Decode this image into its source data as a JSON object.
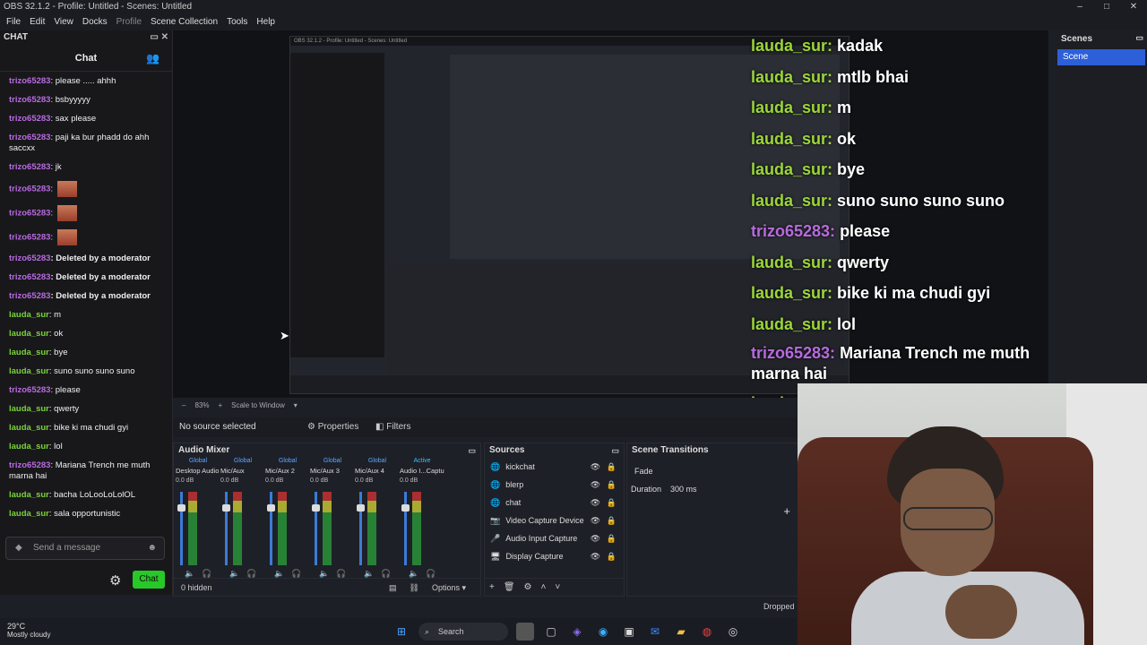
{
  "window": {
    "title": "OBS 32.1.2 - Profile: Untitled - Scenes: Untitled",
    "controls": [
      "–",
      "□",
      "✕"
    ]
  },
  "menu": [
    "File",
    "Edit",
    "View",
    "Docks",
    "Profile",
    "Scene Collection",
    "Tools",
    "Help"
  ],
  "chat_dock": {
    "dock_title": "CHAT",
    "header": "Chat",
    "messages": [
      {
        "user": "trizo65283",
        "text": "please ..... ahhh",
        "cls": "u1"
      },
      {
        "user": "trizo65283",
        "text": "bsbyyyyy",
        "cls": "u1"
      },
      {
        "user": "trizo65283",
        "text": "sax please",
        "cls": "u1"
      },
      {
        "user": "trizo65283",
        "text": "paji ka bur phadd do ahh saccxx",
        "cls": "u1"
      },
      {
        "user": "trizo65283",
        "text": "jk",
        "cls": "u1"
      },
      {
        "user": "trizo65283",
        "text": "",
        "cls": "u1",
        "emote": true
      },
      {
        "user": "trizo65283",
        "text": "",
        "cls": "u1",
        "emote": true
      },
      {
        "user": "trizo65283",
        "text": "",
        "cls": "u1",
        "emote": true
      },
      {
        "user": "trizo65283",
        "text": "Deleted by a moderator",
        "cls": "u1",
        "sys": true
      },
      {
        "user": "trizo65283",
        "text": "Deleted by a moderator",
        "cls": "u1",
        "sys": true
      },
      {
        "user": "trizo65283",
        "text": "Deleted by a moderator",
        "cls": "u1",
        "sys": true
      },
      {
        "user": "lauda_sur",
        "text": "m",
        "cls": "u2"
      },
      {
        "user": "lauda_sur",
        "text": "ok",
        "cls": "u2"
      },
      {
        "user": "lauda_sur",
        "text": "bye",
        "cls": "u2"
      },
      {
        "user": "lauda_sur",
        "text": "suno suno suno suno",
        "cls": "u2"
      },
      {
        "user": "trizo65283",
        "text": "please",
        "cls": "u1"
      },
      {
        "user": "lauda_sur",
        "text": "qwerty",
        "cls": "u2"
      },
      {
        "user": "lauda_sur",
        "text": "bike ki ma chudi gyi",
        "cls": "u2"
      },
      {
        "user": "lauda_sur",
        "text": "lol",
        "cls": "u2"
      },
      {
        "user": "trizo65283",
        "text": "Mariana Trench me muth marna hai",
        "cls": "u1"
      },
      {
        "user": "lauda_sur",
        "text": "bacha LoLooLoLolOL",
        "cls": "u2"
      },
      {
        "user": "lauda_sur",
        "text": "sala opportunistic",
        "cls": "u2"
      }
    ],
    "input_placeholder": "Send a message",
    "send_label": "Chat"
  },
  "overlay_chat": [
    {
      "user": "lauda_sur:",
      "text": "kadak",
      "cls": "ou2"
    },
    {
      "user": "lauda_sur:",
      "text": "mtlb bhai",
      "cls": "ou2"
    },
    {
      "user": "lauda_sur:",
      "text": "m",
      "cls": "ou2"
    },
    {
      "user": "lauda_sur:",
      "text": "ok",
      "cls": "ou2"
    },
    {
      "user": "lauda_sur:",
      "text": "bye",
      "cls": "ou2"
    },
    {
      "user": "lauda_sur:",
      "text": "suno suno suno suno",
      "cls": "ou2"
    },
    {
      "user": "trizo65283:",
      "text": "please",
      "cls": "ou1"
    },
    {
      "user": "lauda_sur:",
      "text": "qwerty",
      "cls": "ou2"
    },
    {
      "user": "lauda_sur:",
      "text": "bike ki ma chudi gyi",
      "cls": "ou2"
    },
    {
      "user": "lauda_sur:",
      "text": "lol",
      "cls": "ou2"
    },
    {
      "user": "trizo65283:",
      "text": "Mariana Trench me muth marna hai",
      "cls": "ou1",
      "wrap": true
    },
    {
      "user": "lauda_sur:",
      "text": "bacha LoLooLoLolOL",
      "cls": "ou2"
    }
  ],
  "scenes": {
    "title": "Scenes",
    "items": [
      "Scene"
    ]
  },
  "preview_bar": {
    "zoom": "83%",
    "scale": "Scale to Window"
  },
  "source_bar": {
    "status": "No source selected",
    "properties": "Properties",
    "filters": "Filters"
  },
  "mixer": {
    "title": "Audio Mixer",
    "channels": [
      {
        "tag": "Global",
        "name": "Desktop Audio",
        "db": "0.0 dB"
      },
      {
        "tag": "Global",
        "name": "Mic/Aux",
        "db": "0.0 dB"
      },
      {
        "tag": "Global",
        "name": "Mic/Aux 2",
        "db": "0.0 dB"
      },
      {
        "tag": "Global",
        "name": "Mic/Aux 3",
        "db": "0.0 dB"
      },
      {
        "tag": "Global",
        "name": "Mic/Aux 4",
        "db": "0.0 dB"
      },
      {
        "tag": "Active",
        "name": "Audio I...Capture",
        "db": "0.0 dB"
      }
    ],
    "hidden": "0 hidden",
    "options": "Options"
  },
  "sources": {
    "title": "Sources",
    "items": [
      {
        "name": "kickchat",
        "icon": "browser-icon"
      },
      {
        "name": "blerp",
        "icon": "browser-icon"
      },
      {
        "name": "chat",
        "icon": "browser-icon"
      },
      {
        "name": "Video Capture Device",
        "icon": "camera-icon"
      },
      {
        "name": "Audio Input Capture",
        "icon": "mic-icon"
      },
      {
        "name": "Display Capture",
        "icon": "monitor-icon"
      }
    ]
  },
  "transitions": {
    "title": "Scene Transitions",
    "type": "Fade",
    "duration_label": "Duration",
    "duration": "300 ms"
  },
  "status": {
    "dropped": "Dropped"
  },
  "taskbar": {
    "temp": "29°C",
    "weather": "Mostly cloudy",
    "search": "Search"
  }
}
